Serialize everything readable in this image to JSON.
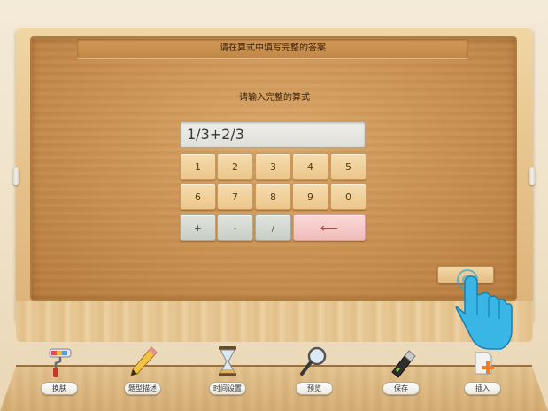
{
  "header": {
    "title": "请在算式中填写完整的答案"
  },
  "prompt": "请输入完整的算式",
  "expression": {
    "value": "1/3+2/3"
  },
  "keypad": {
    "row1": [
      "1",
      "2",
      "3",
      "4",
      "5"
    ],
    "row2": [
      "6",
      "7",
      "8",
      "9",
      "0"
    ],
    "ops": [
      "+",
      "-",
      "/"
    ],
    "backspace": "⟵"
  },
  "toolbar": {
    "items": [
      {
        "label": "换肤",
        "icon": "paint-roller-icon"
      },
      {
        "label": "题型描述",
        "icon": "pencil-icon"
      },
      {
        "label": "时间设置",
        "icon": "hourglass-icon"
      },
      {
        "label": "预览",
        "icon": "magnifier-icon"
      },
      {
        "label": "保存",
        "icon": "usb-drive-icon"
      },
      {
        "label": "插入",
        "icon": "insert-add-icon"
      }
    ]
  },
  "colors": {
    "backspace": "#d23a3a",
    "accent_blue": "#2aa8d8"
  }
}
